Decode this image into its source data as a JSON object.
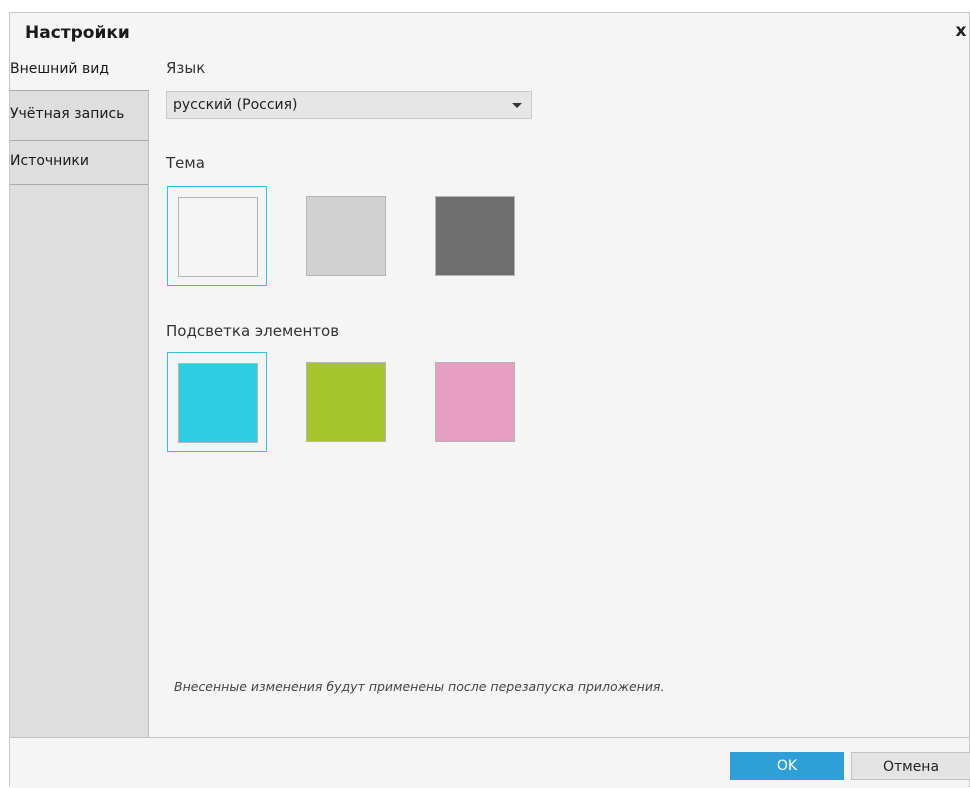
{
  "dialog": {
    "title": "Настройки",
    "close_glyph": "x"
  },
  "sidebar": {
    "items": [
      {
        "label": "Внешний вид",
        "active": true
      },
      {
        "label": "Учётная запись",
        "active": false
      },
      {
        "label": "Источники",
        "active": false
      }
    ]
  },
  "appearance": {
    "language": {
      "label": "Язык",
      "selected": "русский (Россия)"
    },
    "theme": {
      "label": "Тема",
      "options": [
        {
          "name": "light-theme",
          "color": "#f5f5f5",
          "selected": true
        },
        {
          "name": "gray-theme",
          "color": "#d1d1d1",
          "selected": false
        },
        {
          "name": "dark-theme",
          "color": "#6e6e6e",
          "selected": false
        }
      ]
    },
    "highlight": {
      "label": "Подсветка элементов",
      "options": [
        {
          "name": "cyan-highlight",
          "color": "#2ecde3",
          "selected": true
        },
        {
          "name": "green-highlight",
          "color": "#a6c52c",
          "selected": false
        },
        {
          "name": "pink-highlight",
          "color": "#e69fc3",
          "selected": false
        }
      ]
    },
    "note": "Внесенные изменения будут применены после перезапуска приложения."
  },
  "footer": {
    "ok_label": "OK",
    "cancel_label": "Отмена"
  },
  "colors": {
    "accent": "#2f9fd8",
    "selection_border": "#2fc3e0",
    "sidebar_bg": "#dedede",
    "panel_bg": "#f5f5f5"
  }
}
